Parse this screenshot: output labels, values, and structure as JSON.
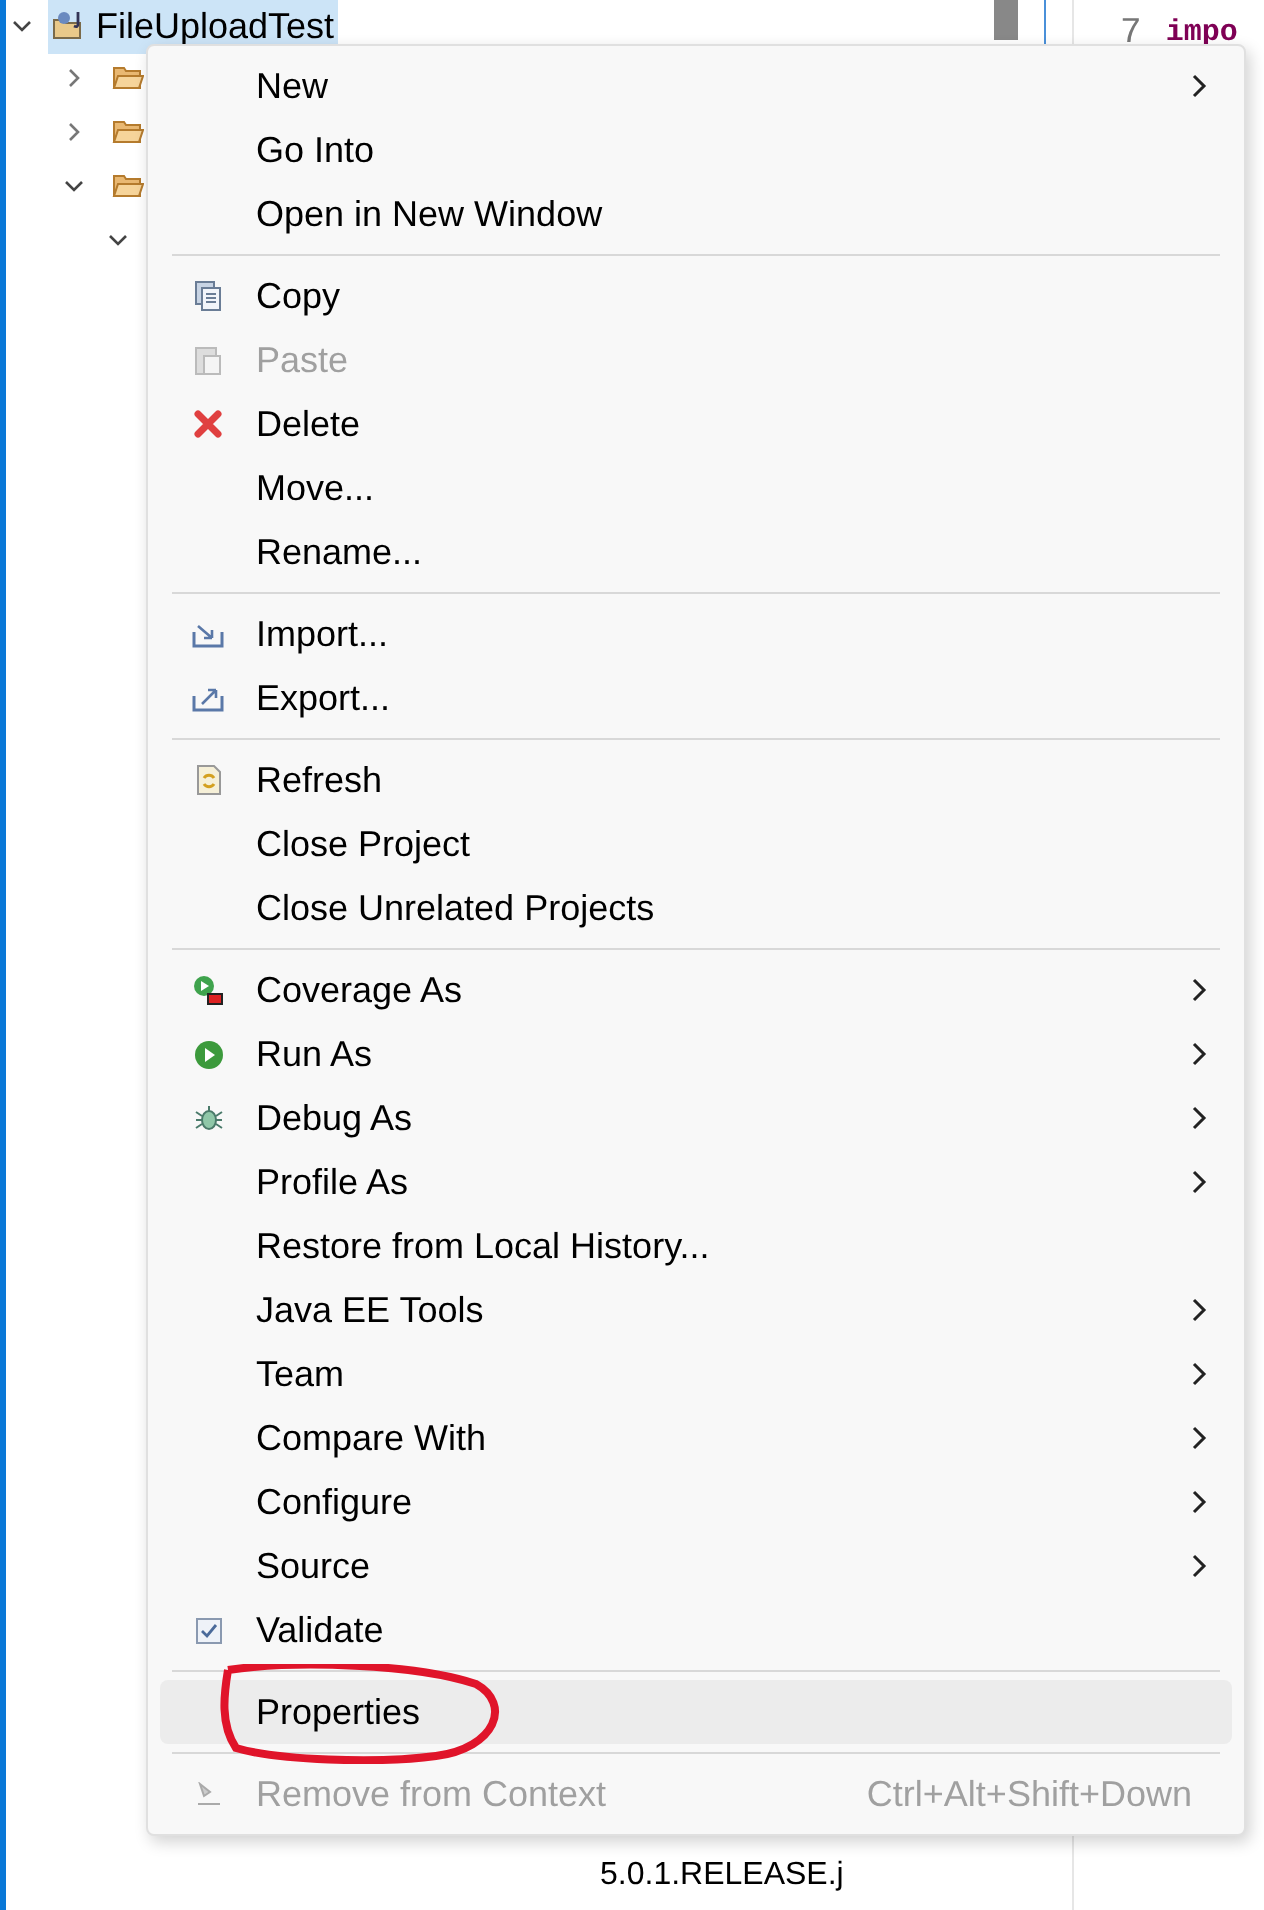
{
  "project_tree": {
    "root": {
      "label": "FileUploadTest",
      "selected": true,
      "expanded": true
    },
    "rows": [
      {
        "expanded": false
      },
      {
        "expanded": false
      },
      {
        "expanded": true
      },
      {
        "expanded": true
      }
    ],
    "bottom_row": {
      "label": "5.0.1.RELEASE.j"
    }
  },
  "editor": {
    "line_number": "7",
    "code": "impo"
  },
  "context_menu": {
    "items": [
      {
        "kind": "item",
        "label": "New",
        "submenu": true,
        "disabled": false,
        "selected": false
      },
      {
        "kind": "item",
        "label": "Go Into",
        "submenu": false,
        "disabled": false,
        "selected": false
      },
      {
        "kind": "item",
        "label": "Open in New Window",
        "submenu": false,
        "disabled": false,
        "selected": false
      },
      {
        "kind": "separator"
      },
      {
        "kind": "item",
        "label": "Copy",
        "submenu": false,
        "disabled": false,
        "selected": false
      },
      {
        "kind": "item",
        "label": "Paste",
        "submenu": false,
        "disabled": true,
        "selected": false
      },
      {
        "kind": "item",
        "label": "Delete",
        "submenu": false,
        "disabled": false,
        "selected": false
      },
      {
        "kind": "item",
        "label": "Move...",
        "submenu": false,
        "disabled": false,
        "selected": false
      },
      {
        "kind": "item",
        "label": "Rename...",
        "submenu": false,
        "disabled": false,
        "selected": false
      },
      {
        "kind": "separator"
      },
      {
        "kind": "item",
        "label": "Import...",
        "submenu": false,
        "disabled": false,
        "selected": false
      },
      {
        "kind": "item",
        "label": "Export...",
        "submenu": false,
        "disabled": false,
        "selected": false
      },
      {
        "kind": "separator"
      },
      {
        "kind": "item",
        "label": "Refresh",
        "submenu": false,
        "disabled": false,
        "selected": false
      },
      {
        "kind": "item",
        "label": "Close Project",
        "submenu": false,
        "disabled": false,
        "selected": false
      },
      {
        "kind": "item",
        "label": "Close Unrelated Projects",
        "submenu": false,
        "disabled": false,
        "selected": false
      },
      {
        "kind": "separator"
      },
      {
        "kind": "item",
        "label": "Coverage As",
        "submenu": true,
        "disabled": false,
        "selected": false
      },
      {
        "kind": "item",
        "label": "Run As",
        "submenu": true,
        "disabled": false,
        "selected": false
      },
      {
        "kind": "item",
        "label": "Debug As",
        "submenu": true,
        "disabled": false,
        "selected": false
      },
      {
        "kind": "item",
        "label": "Profile As",
        "submenu": true,
        "disabled": false,
        "selected": false
      },
      {
        "kind": "item",
        "label": "Restore from Local History...",
        "submenu": false,
        "disabled": false,
        "selected": false
      },
      {
        "kind": "item",
        "label": "Java EE Tools",
        "submenu": true,
        "disabled": false,
        "selected": false
      },
      {
        "kind": "item",
        "label": "Team",
        "submenu": true,
        "disabled": false,
        "selected": false
      },
      {
        "kind": "item",
        "label": "Compare With",
        "submenu": true,
        "disabled": false,
        "selected": false
      },
      {
        "kind": "item",
        "label": "Configure",
        "submenu": true,
        "disabled": false,
        "selected": false
      },
      {
        "kind": "item",
        "label": "Source",
        "submenu": true,
        "disabled": false,
        "selected": false
      },
      {
        "kind": "item",
        "label": "Validate",
        "submenu": false,
        "disabled": false,
        "selected": false
      },
      {
        "kind": "separator"
      },
      {
        "kind": "item",
        "label": "Properties",
        "submenu": false,
        "disabled": false,
        "selected": true
      },
      {
        "kind": "separator"
      },
      {
        "kind": "item",
        "label": "Remove from Context",
        "shortcut": "Ctrl+Alt+Shift+Down",
        "submenu": false,
        "disabled": true,
        "selected": false
      }
    ]
  }
}
